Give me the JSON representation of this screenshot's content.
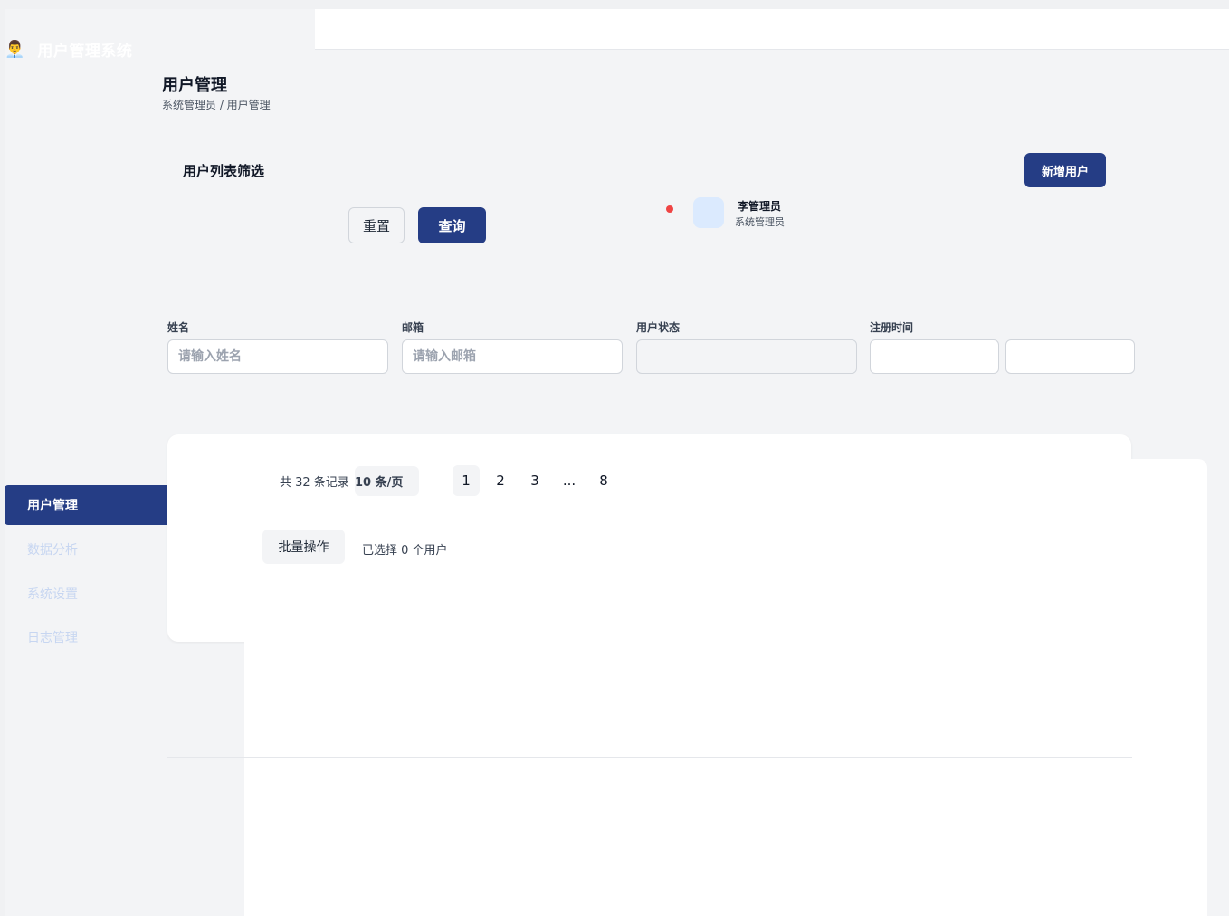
{
  "app": {
    "logo_icon": "👨‍💼",
    "logo_icon_name": "admin-person-icon",
    "title": "用户管理系统"
  },
  "header": {
    "page_title": "用户管理",
    "breadcrumb": "系统管理员 / 用户管理"
  },
  "user": {
    "name": "李管理员",
    "role": "系统管理员",
    "notification_dot_color": "#ef4444"
  },
  "filter": {
    "title": "用户列表筛选",
    "add_button": "新增用户",
    "reset_button": "重置",
    "query_button": "查询",
    "fields": {
      "name": {
        "label": "姓名",
        "placeholder": "请输入姓名",
        "value": ""
      },
      "email": {
        "label": "邮箱",
        "placeholder": "请输入邮箱",
        "value": ""
      },
      "status": {
        "label": "用户状态",
        "value": ""
      },
      "register_time": {
        "label": "注册时间",
        "start": "",
        "end": ""
      }
    }
  },
  "sidebar": {
    "items": [
      {
        "label": "用户管理",
        "active": true
      },
      {
        "label": "数据分析",
        "active": false
      },
      {
        "label": "系统设置",
        "active": false
      },
      {
        "label": "日志管理",
        "active": false
      }
    ]
  },
  "table": {
    "total_text": "共 32 条记录",
    "page_size": "10 条/页",
    "pages": [
      "1",
      "2",
      "3",
      "...",
      "8"
    ],
    "current_page": "1",
    "batch_button": "批量操作",
    "selected_text": "已选择 0 个用户"
  },
  "colors": {
    "primary": "#253d85",
    "background": "#f3f4f6",
    "sidebar_muted_text": "#c7d6f1"
  }
}
